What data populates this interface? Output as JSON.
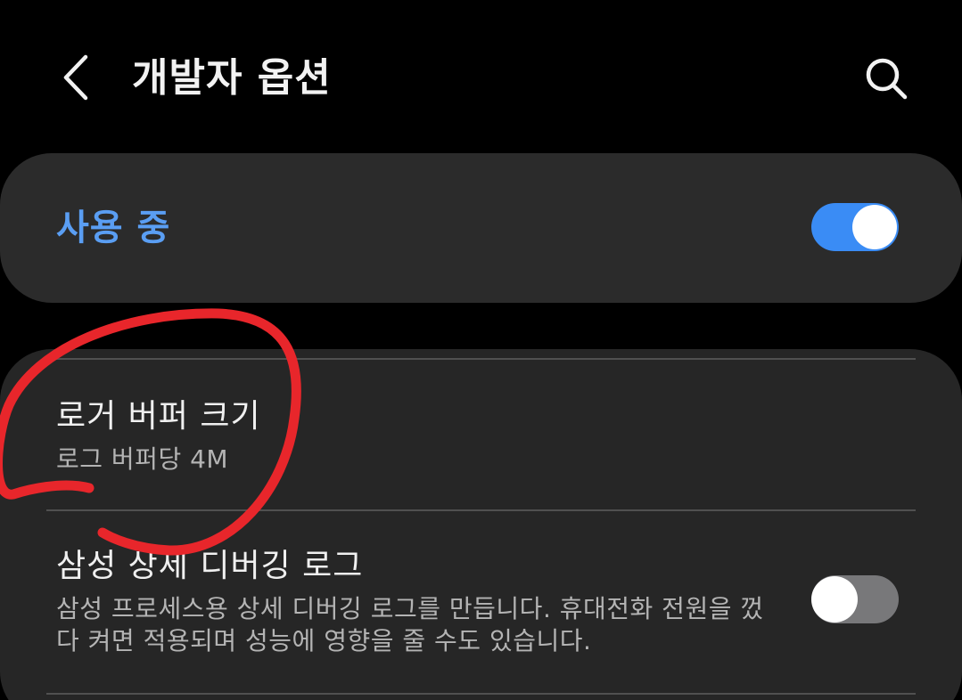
{
  "header": {
    "title": "개발자 옵션",
    "back_icon": "chevron-left-icon",
    "search_icon": "search-icon"
  },
  "master_switch": {
    "label": "사용 중",
    "state": "on"
  },
  "settings": [
    {
      "title": "로거 버퍼 크기",
      "subtitle": "로그 버퍼당 4M"
    },
    {
      "title": "삼성 상세 디버깅 로그",
      "subtitle": "삼성 프로세스용 상세 디버깅 로그를 만듭니다. 휴대전화 전원을 껐다 켜면 적용되며 성능에 영향을 줄 수도 있습니다.",
      "toggle_state": "off"
    }
  ],
  "colors": {
    "background": "#000000",
    "card": "#2b2b2b",
    "accent_blue": "#3a8cf5",
    "label_blue": "#5a9ef3",
    "annotation_red": "#e8262b"
  }
}
